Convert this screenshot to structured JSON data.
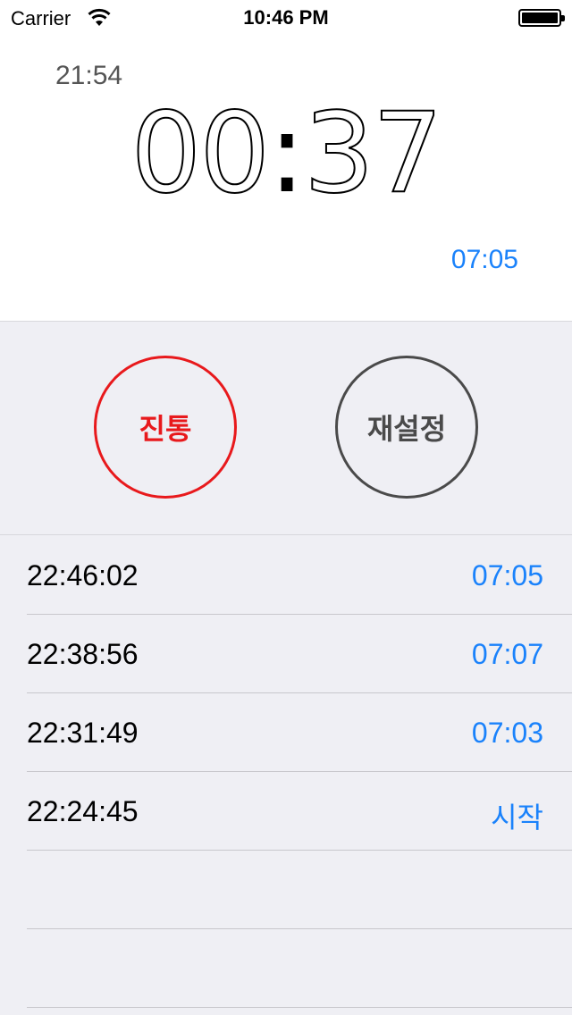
{
  "status": {
    "carrier": "Carrier",
    "time": "10:46 PM"
  },
  "timer": {
    "total": "21:54",
    "main": "00:37",
    "main_left": "00",
    "main_right": "37",
    "current_lap": "07:05"
  },
  "buttons": {
    "lap": "진통",
    "reset": "재설정"
  },
  "laps": [
    {
      "time": "22:46:02",
      "split": "07:05"
    },
    {
      "time": "22:38:56",
      "split": "07:07"
    },
    {
      "time": "22:31:49",
      "split": "07:03"
    },
    {
      "time": "22:24:45",
      "split": "시작"
    },
    {
      "time": "",
      "split": ""
    },
    {
      "time": "",
      "split": ""
    }
  ],
  "colors": {
    "accent": "#1a82fb",
    "lap_button": "#e8191c",
    "reset_button": "#4a4a4a"
  },
  "icons": {
    "wifi": "wifi-icon",
    "battery": "battery-icon"
  }
}
